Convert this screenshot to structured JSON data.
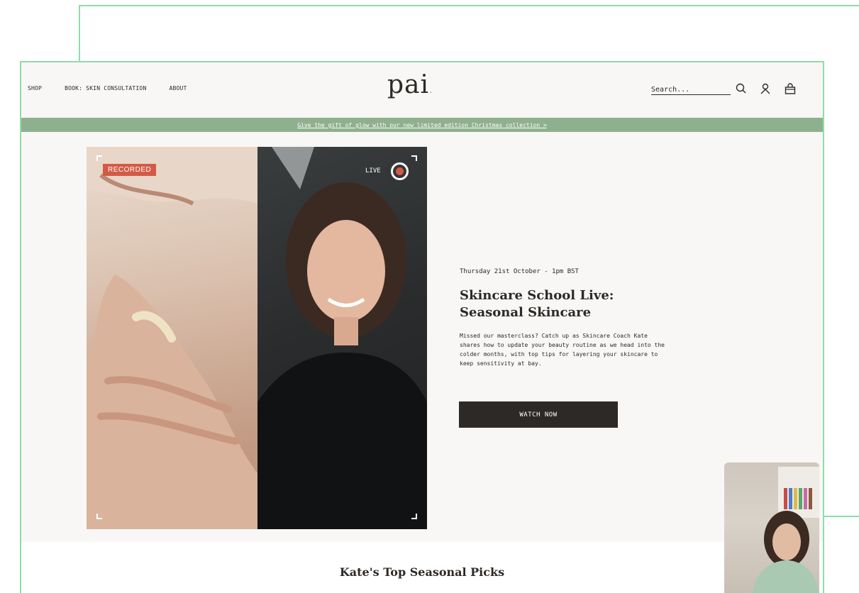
{
  "nav": {
    "items": [
      "SHOP",
      "BOOK: SKIN CONSULTATION",
      "ABOUT"
    ]
  },
  "logo": {
    "text": "pai",
    "dot": "."
  },
  "search": {
    "placeholder": "Search..."
  },
  "icons": {
    "search": "search-icon",
    "account": "user-icon",
    "basket": "basket-icon"
  },
  "promo": {
    "text": "Give the gift of glow with our new limited edition Christmas collection >"
  },
  "hero": {
    "recorded_badge": "RECORDED",
    "live_label": "LIVE",
    "date": "Thursday 21st October - 1pm BST",
    "title_line1": "Skincare School Live:",
    "title_line2": "Seasonal Skincare",
    "description": "Missed our masterclass? Catch up as Skincare Coach Kate shares how to update your beauty routine as we head into the colder months, with top tips for layering your skincare to keep sensitivity at bay.",
    "button": "WATCH NOW"
  },
  "picks": {
    "title": "Kate's Top Seasonal Picks"
  },
  "colors": {
    "accent_green": "#8fb08e",
    "frame_green": "#8fdcaa",
    "dark": "#2d2926",
    "badge_red": "#d35a45"
  }
}
